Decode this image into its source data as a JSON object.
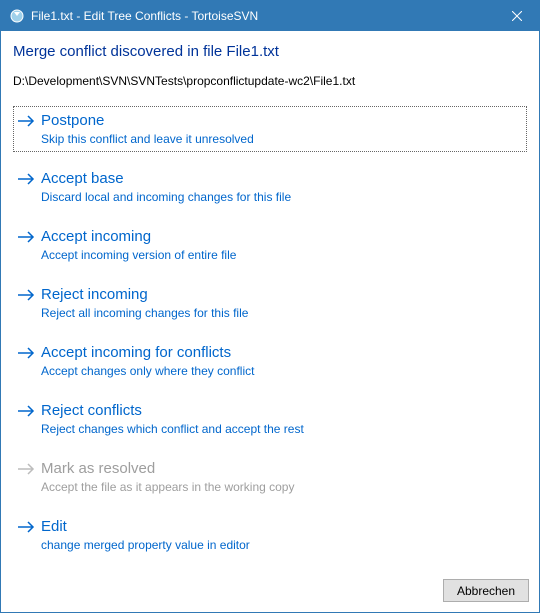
{
  "titlebar": {
    "title": "File1.txt - Edit Tree Conflicts - TortoiseSVN"
  },
  "heading": "Merge conflict discovered in file File1.txt",
  "filepath": "D:\\Development\\SVN\\SVNTests\\propconflictupdate-wc2\\File1.txt",
  "options": [
    {
      "title": "Postpone",
      "desc": "Skip this conflict and leave it unresolved",
      "enabled": true,
      "selected": true
    },
    {
      "title": "Accept base",
      "desc": "Discard local and incoming changes for this file",
      "enabled": true,
      "selected": false
    },
    {
      "title": "Accept incoming",
      "desc": "Accept incoming version of entire file",
      "enabled": true,
      "selected": false
    },
    {
      "title": "Reject incoming",
      "desc": "Reject all incoming changes for this file",
      "enabled": true,
      "selected": false
    },
    {
      "title": "Accept incoming for conflicts",
      "desc": "Accept changes only where they conflict",
      "enabled": true,
      "selected": false
    },
    {
      "title": "Reject conflicts",
      "desc": "Reject changes which conflict and accept the rest",
      "enabled": true,
      "selected": false
    },
    {
      "title": "Mark as resolved",
      "desc": "Accept the file as it appears in the working copy",
      "enabled": false,
      "selected": false
    },
    {
      "title": "Edit",
      "desc": "change merged property value in editor",
      "enabled": true,
      "selected": false
    }
  ],
  "footer": {
    "cancel_label": "Abbrechen"
  }
}
